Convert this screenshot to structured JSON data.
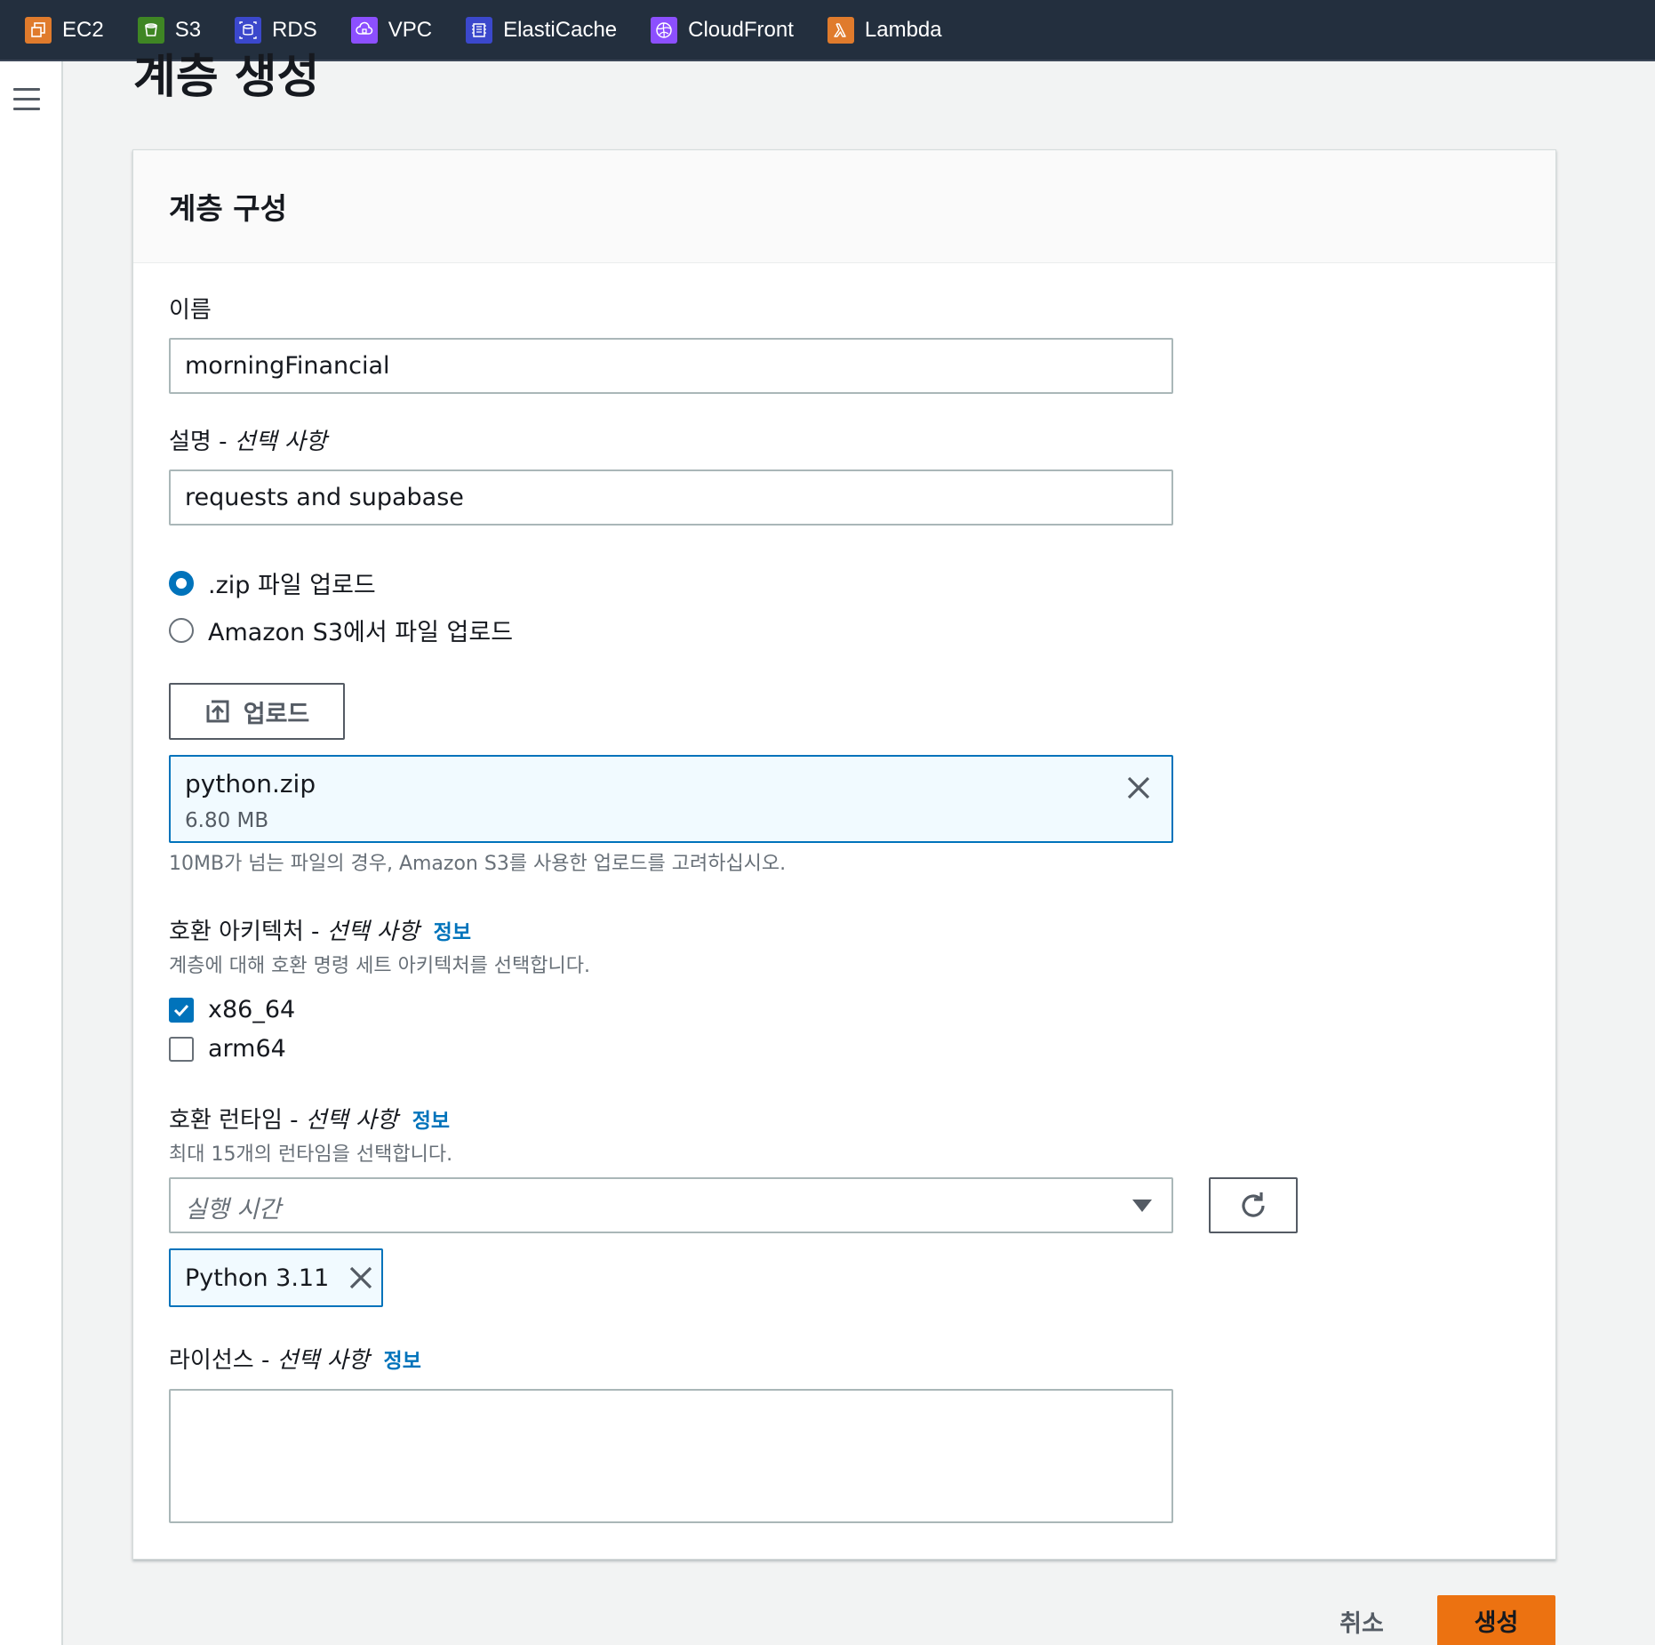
{
  "services": [
    {
      "label": "EC2",
      "icon": "ec2-icon",
      "color": "#e07b2c"
    },
    {
      "label": "S3",
      "icon": "s3-icon",
      "color": "#3f8624"
    },
    {
      "label": "RDS",
      "icon": "rds-icon",
      "color": "#3b48cc"
    },
    {
      "label": "VPC",
      "icon": "vpc-icon",
      "color": "#8c4fff"
    },
    {
      "label": "ElastiCache",
      "icon": "elasticache-icon",
      "color": "#3b48cc"
    },
    {
      "label": "CloudFront",
      "icon": "cloudfront-icon",
      "color": "#8c4fff"
    },
    {
      "label": "Lambda",
      "icon": "lambda-icon",
      "color": "#e07b2c"
    }
  ],
  "page": {
    "title": "계층 생성"
  },
  "container": {
    "title": "계층 구성"
  },
  "name_field": {
    "label": "이름",
    "value": "morningFinancial"
  },
  "description_field": {
    "label": "설명 - ",
    "optional": "선택 사항",
    "value": "requests and supabase"
  },
  "upload_source": {
    "options": [
      {
        "label": ".zip 파일 업로드",
        "selected": true
      },
      {
        "label": "Amazon S3에서 파일 업로드",
        "selected": false
      }
    ]
  },
  "upload_button": {
    "label": "업로드"
  },
  "file": {
    "name": "python.zip",
    "size": "6.80 MB"
  },
  "file_hint": "10MB가 넘는 파일의 경우, Amazon S3를 사용한 업로드를 고려하십시오.",
  "architectures": {
    "label": "호환 아키텍처 - ",
    "optional": "선택 사항",
    "info": "정보",
    "description": "계층에 대해 호환 명령 세트 아키텍처를 선택합니다.",
    "options": [
      {
        "label": "x86_64",
        "checked": true
      },
      {
        "label": "arm64",
        "checked": false
      }
    ]
  },
  "runtimes": {
    "label": "호환 런타임 - ",
    "optional": "선택 사항",
    "info": "정보",
    "description": "최대 15개의 런타임을 선택합니다.",
    "placeholder": "실행 시간",
    "selected": [
      "Python 3.11"
    ]
  },
  "license": {
    "label": "라이선스 - ",
    "optional": "선택 사항",
    "info": "정보",
    "value": ""
  },
  "actions": {
    "cancel": "취소",
    "create": "생성"
  },
  "colors": {
    "accent": "#0073bb",
    "primary_button": "#ec7211",
    "header_bg": "#232f3e"
  }
}
